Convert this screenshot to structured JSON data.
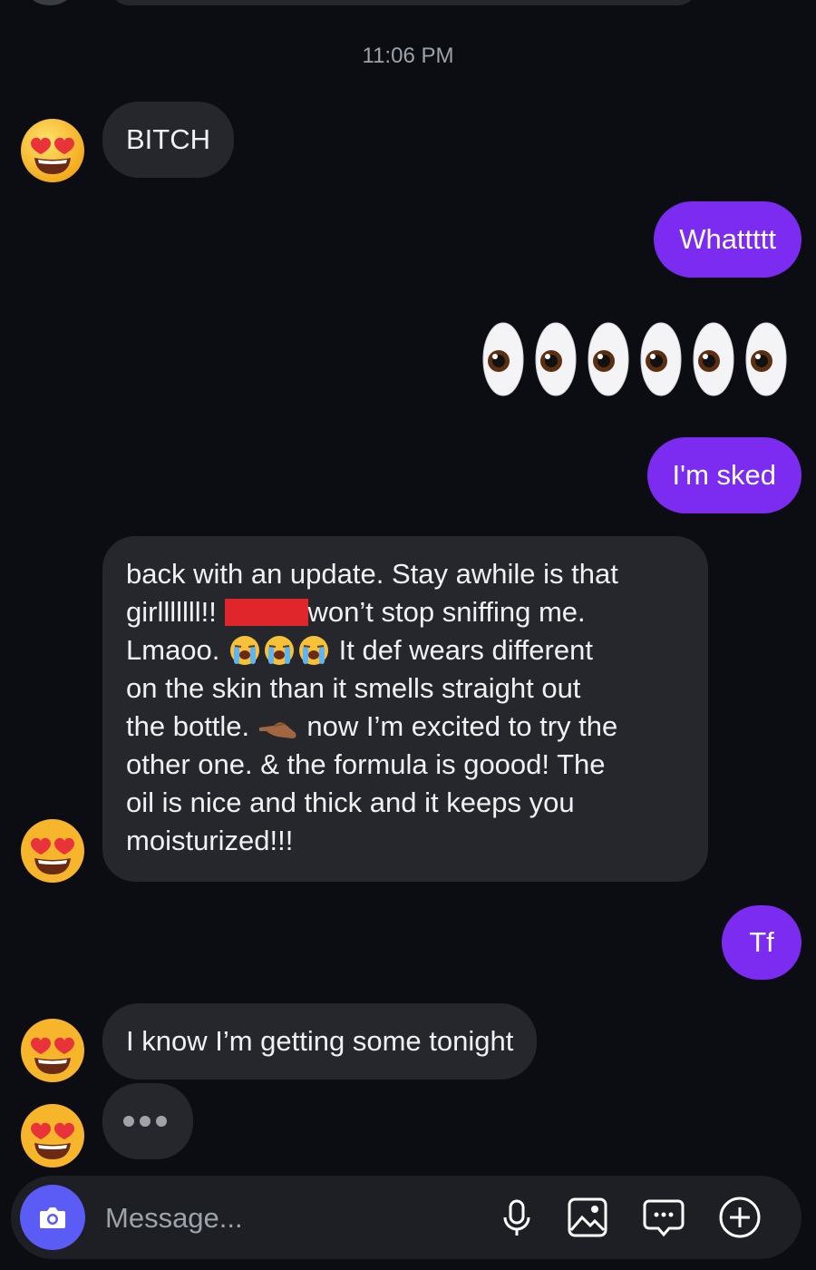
{
  "thread": {
    "timestamp": "11:06 PM",
    "messages": [
      {
        "from": "them",
        "text": "BITCH"
      },
      {
        "from": "me",
        "text": "Whattttt"
      },
      {
        "from": "me",
        "emoji": "eyes",
        "count": 6
      },
      {
        "from": "me",
        "text": "I'm sked"
      },
      {
        "from": "them",
        "lines": {
          "l1": "back with an update. Stay awhile is that",
          "l2a": "girlllllll!! ",
          "l2b": "won’t stop sniffing me.",
          "l3a": "Lmaoo. ",
          "l3b": " It def wears different",
          "l4": "on the skin than it smells straight out",
          "l5a": "the bottle. ",
          "l5b": " now I’m excited to try the",
          "l6": "other one. & the formula is goood! The",
          "l7": "oil is nice and thick and it keeps you",
          "l8": "moisturized!!!"
        }
      },
      {
        "from": "me",
        "text": "Tf"
      },
      {
        "from": "them",
        "text": "I know I’m getting some tonight"
      },
      {
        "from": "them",
        "typing": true
      }
    ]
  },
  "composer": {
    "placeholder": "Message...",
    "icons": [
      "camera-icon",
      "microphone-icon",
      "image-icon",
      "chat-bubble-icon",
      "plus-icon"
    ]
  },
  "colors": {
    "background": "#0b0d12",
    "incoming_bubble": "#25272c",
    "outgoing_bubble": "#7b2cf0",
    "camera_button": "#5b5cf6"
  }
}
